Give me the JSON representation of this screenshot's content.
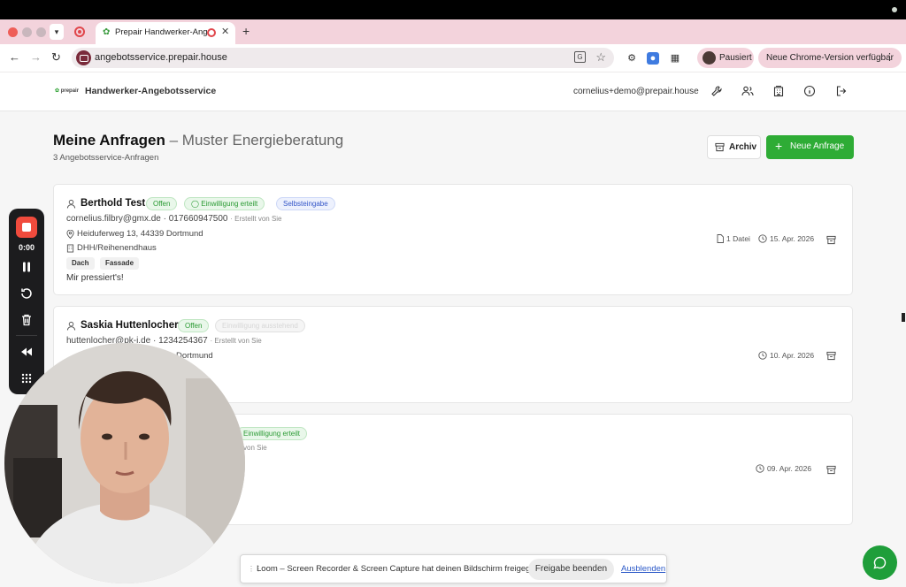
{
  "browser": {
    "tab_title": "Prepair Handwerker-Angebotsservice",
    "url": "angebotsservice.prepair.house",
    "profile_label": "Pausiert",
    "update_label": "Neue Chrome-Version verfügbar",
    "icons": [
      "back-arrow-icon",
      "forward-arrow-icon",
      "reload-icon",
      "translate-icon",
      "bookmark-star-icon",
      "extension-icon",
      "puzzle-icon"
    ]
  },
  "header": {
    "logo": "prepair",
    "app_name": "Handwerker-Angebotsservice",
    "user_email": "cornelius+demo@prepair.house",
    "icons": [
      "wrench-icon",
      "users-icon",
      "building-icon",
      "info-icon",
      "logout-icon"
    ]
  },
  "page": {
    "title": "Meine Anfragen",
    "title_suffix": "– Muster Energieberatung",
    "subtitle": "3 Angebotsservice-Anfragen",
    "archive_label": "Archiv",
    "new_request_label": "Neue Anfrage"
  },
  "cards": [
    {
      "name": "Berthold Test",
      "badges": [
        "Offen",
        "Einwilligung erteilt",
        "Selbsteingabe"
      ],
      "contact": "cornelius.filbry@gmx.de · 017660947500",
      "created_by": "· Erstellt von Sie",
      "address": "Heiduferweg 13, 44339 Dortmund",
      "building": "DHH/Reihenendhaus",
      "tags": [
        "Dach",
        "Fassade"
      ],
      "note": "Mir pressiert's!",
      "files": "1 Datei",
      "date": "15. Apr. 2026"
    },
    {
      "name": "Saskia Huttenlocher",
      "badges": [
        "Offen",
        "Einwilligung ausstehend"
      ],
      "contact": "huttenlocher@pk-i.de · 1234254367",
      "created_by": "· Erstellt von Sie",
      "address_visible": "Dortmund",
      "date": "10. Apr. 2026"
    },
    {
      "badges": [
        "Einwilligung erteilt"
      ],
      "created_by_visible": "von Sie",
      "date": "09. Apr. 2026"
    }
  ],
  "loom": {
    "timer": "0:00",
    "share_message": "Loom – Screen Recorder & Screen Capture hat deinen Bildschirm freigegeben.",
    "stop_share_label": "Freigabe beenden",
    "hide_label": "Ausblenden"
  },
  "colors": {
    "accent_green": "#2eac35",
    "tab_bar_pink": "#f3d3dc",
    "record_red": "#f04b3d",
    "link_blue": "#2a58c8"
  }
}
